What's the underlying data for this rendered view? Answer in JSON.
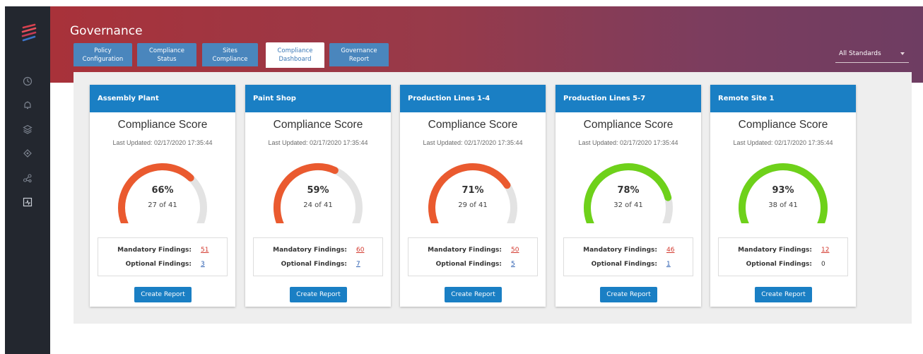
{
  "app": {
    "title": "Governance",
    "tabs": [
      {
        "label": "Policy Configuration",
        "active": false
      },
      {
        "label": "Compliance Status",
        "active": false
      },
      {
        "label": "Sites Compliance",
        "active": false
      },
      {
        "label": "Compliance Dashboard",
        "active": true
      },
      {
        "label": "Governance Report",
        "active": false
      }
    ],
    "standards_filter": {
      "selected": "All Standards"
    }
  },
  "sidebar": {
    "icons": [
      "dashboard-icon",
      "bell-icon",
      "layers-icon",
      "network-icon",
      "share-icon",
      "compliance-icon"
    ]
  },
  "colors": {
    "red_arc": "#ea5a2f",
    "green_arc": "#6ed11a",
    "track": "#e3e3e3",
    "card_header": "#1a7fc4"
  },
  "labels": {
    "score_title": "Compliance Score",
    "mandatory": "Mandatory Findings:",
    "optional": "Optional Findings:",
    "create_report": "Create Report"
  },
  "cards": [
    {
      "site": "Assembly Plant",
      "updated": "Last Updated: 02/17/2020 17:35:44",
      "percent": "66%",
      "fraction": 0.66,
      "count": "27 of 41",
      "status": "red",
      "mandatory": "51",
      "optional": "3",
      "optional_link": true
    },
    {
      "site": "Paint Shop",
      "updated": "Last Updated: 02/17/2020 17:35:44",
      "percent": "59%",
      "fraction": 0.59,
      "count": "24 of 41",
      "status": "red",
      "mandatory": "60",
      "optional": "7",
      "optional_link": true
    },
    {
      "site": "Production Lines 1-4",
      "updated": "Last Updated: 02/17/2020 17:35:44",
      "percent": "71%",
      "fraction": 0.71,
      "count": "29 of 41",
      "status": "red",
      "mandatory": "50",
      "optional": "5",
      "optional_link": true
    },
    {
      "site": "Production Lines 5-7",
      "updated": "Last Updated: 02/17/2020 17:35:44",
      "percent": "78%",
      "fraction": 0.78,
      "count": "32 of 41",
      "status": "green",
      "mandatory": "46",
      "optional": "1",
      "optional_link": true
    },
    {
      "site": "Remote Site 1",
      "updated": "Last Updated: 02/17/2020 17:35:44",
      "percent": "93%",
      "fraction": 0.93,
      "count": "38 of 41",
      "status": "green",
      "mandatory": "12",
      "optional": "0",
      "optional_link": false
    }
  ]
}
